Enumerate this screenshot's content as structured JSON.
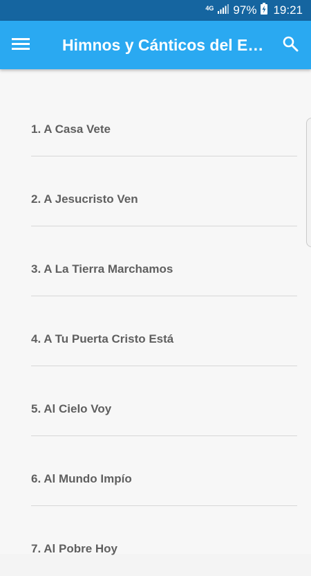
{
  "status_bar": {
    "network": "4G",
    "battery": "97%",
    "time": "19:21"
  },
  "app_bar": {
    "title": "Himnos y Cánticos del E…",
    "menu_icon": "hamburger-menu-icon",
    "search_icon": "search-icon"
  },
  "hymns": [
    {
      "label": "1. A Casa Vete"
    },
    {
      "label": "2. A Jesucristo Ven"
    },
    {
      "label": "3. A La Tierra Marchamos"
    },
    {
      "label": "4. A Tu Puerta Cristo Está"
    },
    {
      "label": "5. Al Cielo Voy"
    },
    {
      "label": "6. Al Mundo Impío"
    },
    {
      "label": "7. Al Pobre Hoy"
    }
  ],
  "colors": {
    "status_bar": "#1565a0",
    "app_bar": "#2aa9f1",
    "list_bg": "#f7f7f7",
    "item_text": "#5f5f5f",
    "divider": "#d7d7d7"
  }
}
